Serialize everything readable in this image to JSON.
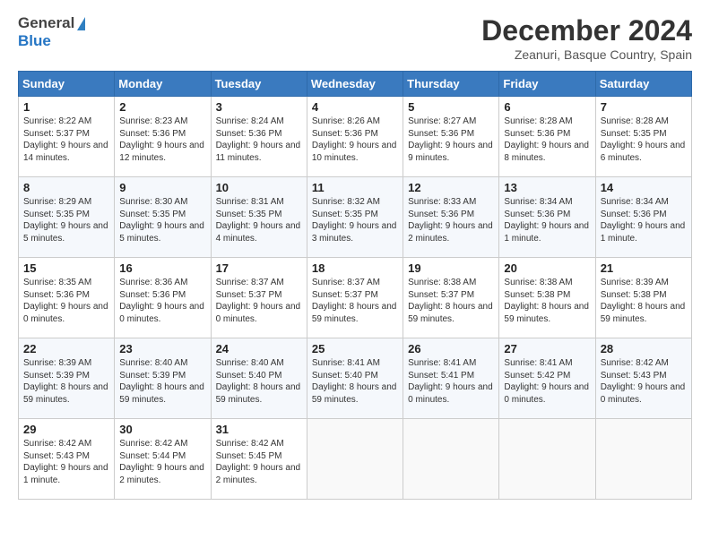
{
  "header": {
    "logo_general": "General",
    "logo_blue": "Blue",
    "month": "December 2024",
    "location": "Zeanuri, Basque Country, Spain"
  },
  "weekdays": [
    "Sunday",
    "Monday",
    "Tuesday",
    "Wednesday",
    "Thursday",
    "Friday",
    "Saturday"
  ],
  "weeks": [
    [
      {
        "day": "1",
        "sunrise": "Sunrise: 8:22 AM",
        "sunset": "Sunset: 5:37 PM",
        "daylight": "Daylight: 9 hours and 14 minutes."
      },
      {
        "day": "2",
        "sunrise": "Sunrise: 8:23 AM",
        "sunset": "Sunset: 5:36 PM",
        "daylight": "Daylight: 9 hours and 12 minutes."
      },
      {
        "day": "3",
        "sunrise": "Sunrise: 8:24 AM",
        "sunset": "Sunset: 5:36 PM",
        "daylight": "Daylight: 9 hours and 11 minutes."
      },
      {
        "day": "4",
        "sunrise": "Sunrise: 8:26 AM",
        "sunset": "Sunset: 5:36 PM",
        "daylight": "Daylight: 9 hours and 10 minutes."
      },
      {
        "day": "5",
        "sunrise": "Sunrise: 8:27 AM",
        "sunset": "Sunset: 5:36 PM",
        "daylight": "Daylight: 9 hours and 9 minutes."
      },
      {
        "day": "6",
        "sunrise": "Sunrise: 8:28 AM",
        "sunset": "Sunset: 5:36 PM",
        "daylight": "Daylight: 9 hours and 8 minutes."
      },
      {
        "day": "7",
        "sunrise": "Sunrise: 8:28 AM",
        "sunset": "Sunset: 5:35 PM",
        "daylight": "Daylight: 9 hours and 6 minutes."
      }
    ],
    [
      {
        "day": "8",
        "sunrise": "Sunrise: 8:29 AM",
        "sunset": "Sunset: 5:35 PM",
        "daylight": "Daylight: 9 hours and 5 minutes."
      },
      {
        "day": "9",
        "sunrise": "Sunrise: 8:30 AM",
        "sunset": "Sunset: 5:35 PM",
        "daylight": "Daylight: 9 hours and 5 minutes."
      },
      {
        "day": "10",
        "sunrise": "Sunrise: 8:31 AM",
        "sunset": "Sunset: 5:35 PM",
        "daylight": "Daylight: 9 hours and 4 minutes."
      },
      {
        "day": "11",
        "sunrise": "Sunrise: 8:32 AM",
        "sunset": "Sunset: 5:35 PM",
        "daylight": "Daylight: 9 hours and 3 minutes."
      },
      {
        "day": "12",
        "sunrise": "Sunrise: 8:33 AM",
        "sunset": "Sunset: 5:36 PM",
        "daylight": "Daylight: 9 hours and 2 minutes."
      },
      {
        "day": "13",
        "sunrise": "Sunrise: 8:34 AM",
        "sunset": "Sunset: 5:36 PM",
        "daylight": "Daylight: 9 hours and 1 minute."
      },
      {
        "day": "14",
        "sunrise": "Sunrise: 8:34 AM",
        "sunset": "Sunset: 5:36 PM",
        "daylight": "Daylight: 9 hours and 1 minute."
      }
    ],
    [
      {
        "day": "15",
        "sunrise": "Sunrise: 8:35 AM",
        "sunset": "Sunset: 5:36 PM",
        "daylight": "Daylight: 9 hours and 0 minutes."
      },
      {
        "day": "16",
        "sunrise": "Sunrise: 8:36 AM",
        "sunset": "Sunset: 5:36 PM",
        "daylight": "Daylight: 9 hours and 0 minutes."
      },
      {
        "day": "17",
        "sunrise": "Sunrise: 8:37 AM",
        "sunset": "Sunset: 5:37 PM",
        "daylight": "Daylight: 9 hours and 0 minutes."
      },
      {
        "day": "18",
        "sunrise": "Sunrise: 8:37 AM",
        "sunset": "Sunset: 5:37 PM",
        "daylight": "Daylight: 8 hours and 59 minutes."
      },
      {
        "day": "19",
        "sunrise": "Sunrise: 8:38 AM",
        "sunset": "Sunset: 5:37 PM",
        "daylight": "Daylight: 8 hours and 59 minutes."
      },
      {
        "day": "20",
        "sunrise": "Sunrise: 8:38 AM",
        "sunset": "Sunset: 5:38 PM",
        "daylight": "Daylight: 8 hours and 59 minutes."
      },
      {
        "day": "21",
        "sunrise": "Sunrise: 8:39 AM",
        "sunset": "Sunset: 5:38 PM",
        "daylight": "Daylight: 8 hours and 59 minutes."
      }
    ],
    [
      {
        "day": "22",
        "sunrise": "Sunrise: 8:39 AM",
        "sunset": "Sunset: 5:39 PM",
        "daylight": "Daylight: 8 hours and 59 minutes."
      },
      {
        "day": "23",
        "sunrise": "Sunrise: 8:40 AM",
        "sunset": "Sunset: 5:39 PM",
        "daylight": "Daylight: 8 hours and 59 minutes."
      },
      {
        "day": "24",
        "sunrise": "Sunrise: 8:40 AM",
        "sunset": "Sunset: 5:40 PM",
        "daylight": "Daylight: 8 hours and 59 minutes."
      },
      {
        "day": "25",
        "sunrise": "Sunrise: 8:41 AM",
        "sunset": "Sunset: 5:40 PM",
        "daylight": "Daylight: 8 hours and 59 minutes."
      },
      {
        "day": "26",
        "sunrise": "Sunrise: 8:41 AM",
        "sunset": "Sunset: 5:41 PM",
        "daylight": "Daylight: 9 hours and 0 minutes."
      },
      {
        "day": "27",
        "sunrise": "Sunrise: 8:41 AM",
        "sunset": "Sunset: 5:42 PM",
        "daylight": "Daylight: 9 hours and 0 minutes."
      },
      {
        "day": "28",
        "sunrise": "Sunrise: 8:42 AM",
        "sunset": "Sunset: 5:43 PM",
        "daylight": "Daylight: 9 hours and 0 minutes."
      }
    ],
    [
      {
        "day": "29",
        "sunrise": "Sunrise: 8:42 AM",
        "sunset": "Sunset: 5:43 PM",
        "daylight": "Daylight: 9 hours and 1 minute."
      },
      {
        "day": "30",
        "sunrise": "Sunrise: 8:42 AM",
        "sunset": "Sunset: 5:44 PM",
        "daylight": "Daylight: 9 hours and 2 minutes."
      },
      {
        "day": "31",
        "sunrise": "Sunrise: 8:42 AM",
        "sunset": "Sunset: 5:45 PM",
        "daylight": "Daylight: 9 hours and 2 minutes."
      },
      null,
      null,
      null,
      null
    ]
  ]
}
